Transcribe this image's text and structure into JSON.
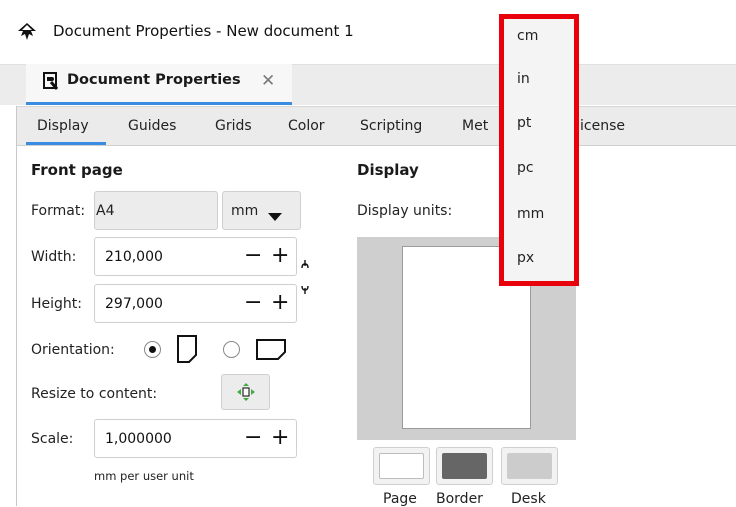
{
  "window": {
    "title": "Document Properties - New document 1"
  },
  "dock_tab": {
    "label": "Document Properties",
    "close": "✕"
  },
  "tabs": [
    "Display",
    "Guides",
    "Grids",
    "Color",
    "Scripting",
    "Metadata",
    "License"
  ],
  "tabs_visible": {
    "metadata_visible": "Met",
    "license_visible": "icense"
  },
  "front_page": {
    "heading": "Front page",
    "format_label": "Format:",
    "format_value": "A4",
    "unit_value": "mm",
    "width_label": "Width:",
    "width_value": "210,000",
    "height_label": "Height:",
    "height_value": "297,000",
    "orientation_label": "Orientation:",
    "resize_label": "Resize to content:",
    "scale_label": "Scale:",
    "scale_value": "1,000000",
    "scale_hint": "mm  per user unit"
  },
  "display": {
    "heading": "Display",
    "units_label": "Display units:",
    "swatches": [
      {
        "label": "Page",
        "color": "#ffffff"
      },
      {
        "label": "Border",
        "color": "#666666"
      },
      {
        "label": "Desk",
        "color": "#cccccc"
      }
    ]
  },
  "unit_dropdown": {
    "options": [
      "cm",
      "in",
      "pt",
      "pc",
      "mm",
      "px"
    ],
    "highlight_color": "#e8000b"
  }
}
